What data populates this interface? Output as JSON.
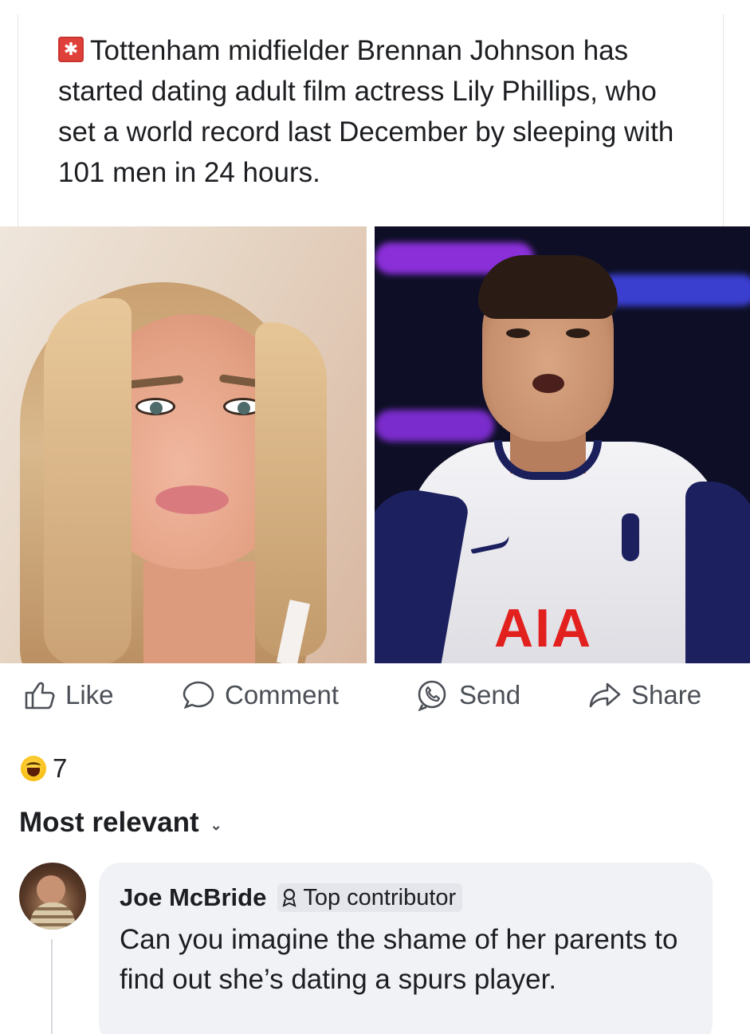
{
  "post": {
    "headline": "Tottenham midfielder Brennan Johnson has started dating adult film actress Lily Phillips, who set a world record last December by sleeping with 101 men in 24 hours.",
    "headline_icon": "alert-icon",
    "photo_sponsor_text": "AIA"
  },
  "actions": {
    "like": "Like",
    "comment": "Comment",
    "send": "Send",
    "share": "Share"
  },
  "reactions": {
    "emoji": "haha-emoji-icon",
    "count": "7"
  },
  "comments": {
    "sort_label": "Most relevant",
    "items": [
      {
        "author": "Joe McBride",
        "badge": "Top contributor",
        "text": "Can you imagine the shame of her parents to find out she’s dating a spurs player."
      }
    ]
  },
  "colors": {
    "action_text": "#4b4f56",
    "bubble_bg": "#f0f2f5",
    "alert_red": "#e0403a",
    "sponsor_red": "#e2201d",
    "kit_navy": "#1c205e"
  }
}
